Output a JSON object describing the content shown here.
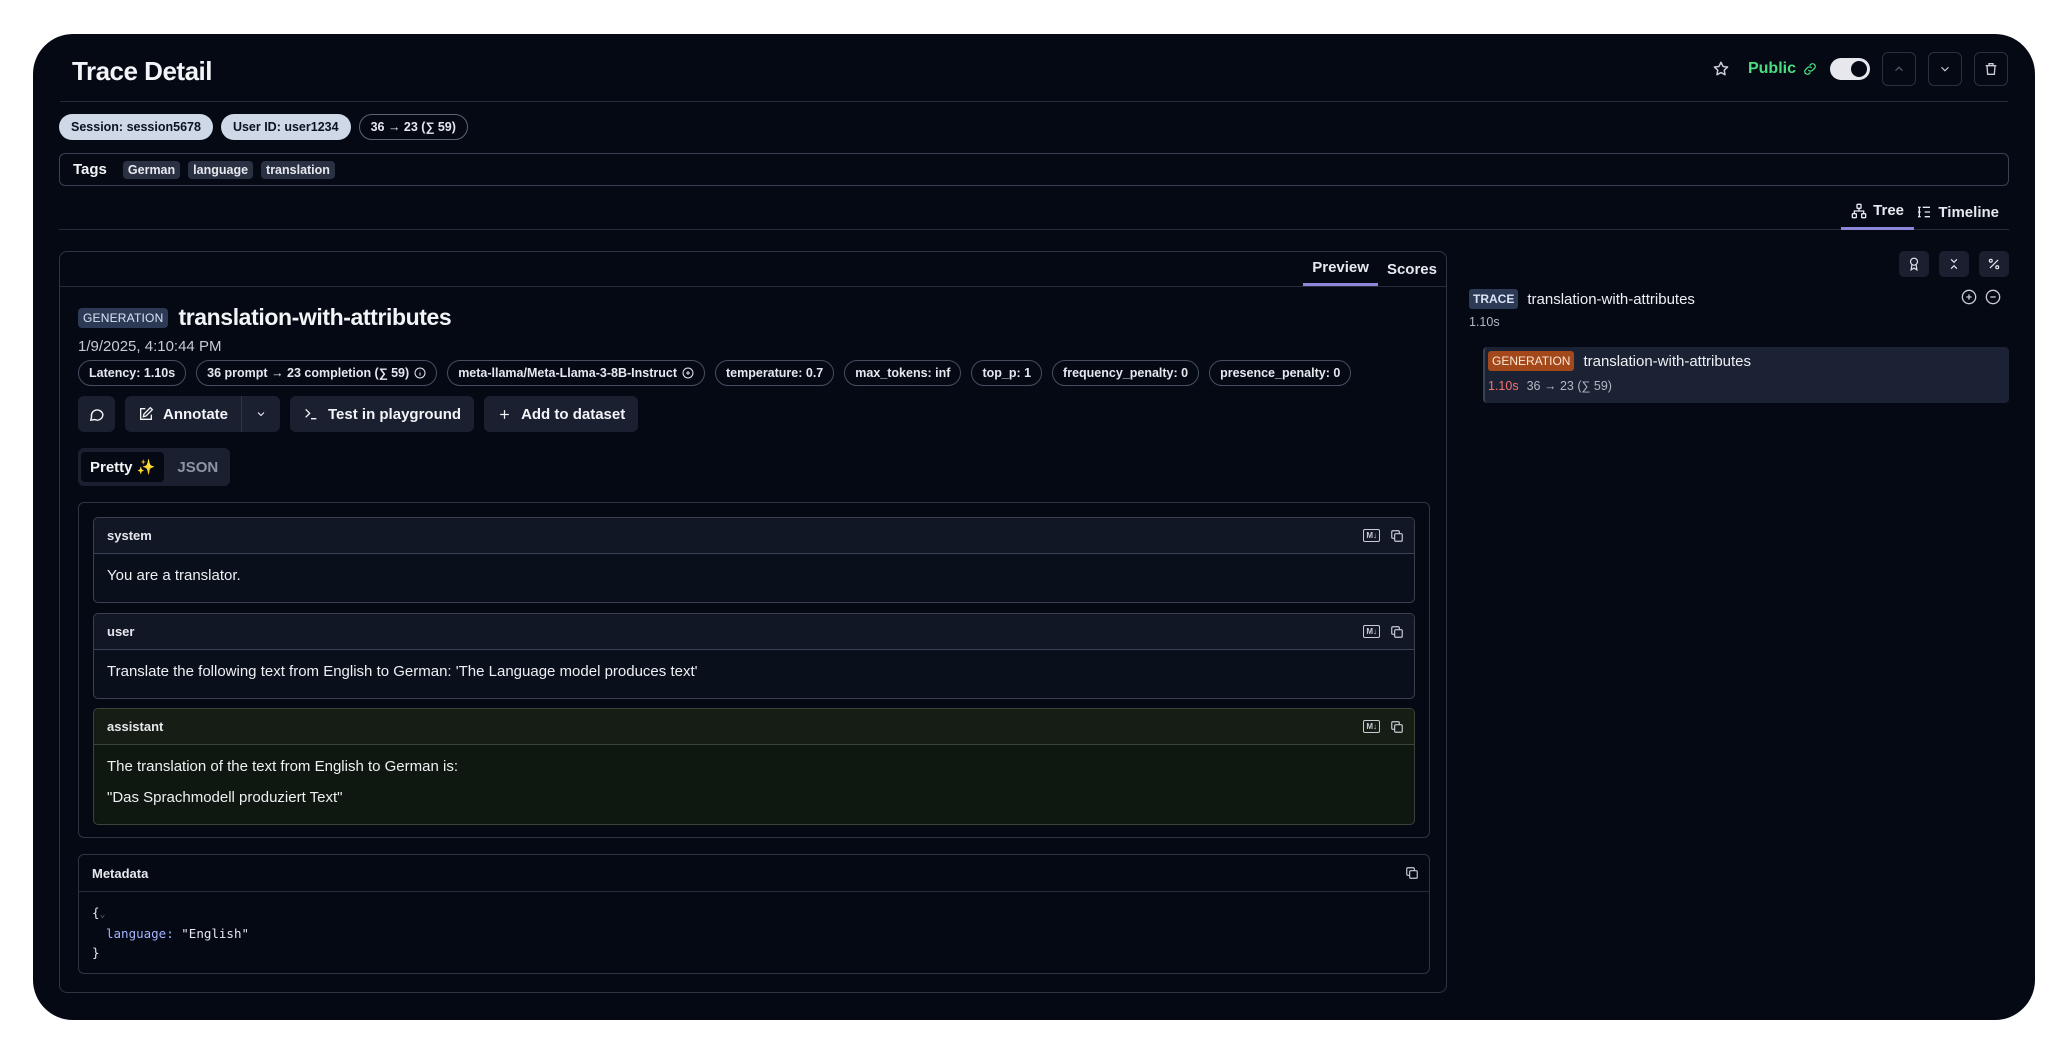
{
  "header": {
    "title": "Trace Detail",
    "public_label": "Public",
    "public_enabled": true
  },
  "badges": {
    "session": "Session: session5678",
    "user": "User ID: user1234",
    "tokens": "36 → 23 (∑ 59)"
  },
  "tags": {
    "label": "Tags",
    "items": [
      "German",
      "language",
      "translation"
    ]
  },
  "view_tabs": [
    {
      "label": "Tree",
      "icon": "tree-icon",
      "active": true
    },
    {
      "label": "Timeline",
      "icon": "timeline-icon",
      "active": false
    }
  ],
  "observation": {
    "tabs": [
      {
        "label": "Preview",
        "active": true
      },
      {
        "label": "Scores",
        "active": false
      }
    ],
    "type_badge": "GENERATION",
    "name": "translation-with-attributes",
    "timestamp": "1/9/2025, 4:10:44 PM",
    "attributes": [
      "Latency: 1.10s",
      "36 prompt → 23 completion (∑ 59)",
      "meta-llama/Meta-Llama-3-8B-Instruct",
      "temperature: 0.7",
      "max_tokens: inf",
      "top_p: 1",
      "frequency_penalty: 0",
      "presence_penalty: 0"
    ],
    "actions": {
      "annotate": "Annotate",
      "playground": "Test in playground",
      "dataset": "Add to dataset"
    },
    "format": {
      "pretty": "Pretty ✨",
      "json": "JSON",
      "selected": "Pretty"
    },
    "messages": [
      {
        "role": "system",
        "lines": [
          "You are a translator."
        ]
      },
      {
        "role": "user",
        "lines": [
          "Translate the following text from English to German: 'The Language model produces text'"
        ]
      },
      {
        "role": "assistant",
        "lines": [
          "The translation of the text from English to German is:",
          "\"Das Sprachmodell produziert Text\""
        ]
      }
    ],
    "metadata": {
      "title": "Metadata",
      "open": "{",
      "key": "language:",
      "value": "\"English\"",
      "close": "}"
    }
  },
  "tree": {
    "trace": {
      "badge": "TRACE",
      "name": "translation-with-attributes",
      "duration": "1.10s"
    },
    "generation": {
      "badge": "GENERATION",
      "name": "translation-with-attributes",
      "latency": "1.10s",
      "tokens": "36 → 23 (∑ 59)"
    }
  },
  "colors": {
    "background": "#050914",
    "accent": "#8b87d9",
    "public_green": "#4ade80",
    "generation_badge": "#a3481a",
    "latency_red": "#f87171"
  }
}
